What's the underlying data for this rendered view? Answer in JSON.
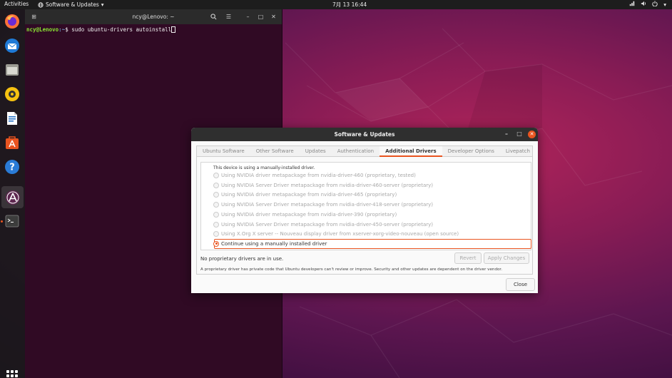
{
  "topbar": {
    "activities": "Activities",
    "app_name": "Software & Updates",
    "clock": "7月 13  16:44"
  },
  "dock": {
    "items": [
      {
        "name": "firefox-icon"
      },
      {
        "name": "thunderbird-icon"
      },
      {
        "name": "files-icon"
      },
      {
        "name": "rhythmbox-icon"
      },
      {
        "name": "libreoffice-writer-icon"
      },
      {
        "name": "software-center-icon"
      },
      {
        "name": "help-icon"
      },
      {
        "name": "software-updater-icon"
      },
      {
        "name": "terminal-icon"
      }
    ]
  },
  "terminal": {
    "title": "ncy@Lenovo: ~",
    "prompt_user": "ncy@Lenovo",
    "prompt_path": ":~",
    "prompt_symbol": "$ ",
    "command": "sudo ubuntu-drivers autoinstall"
  },
  "dialog": {
    "title": "Software & Updates",
    "tabs": [
      {
        "label": "Ubuntu Software",
        "active": false
      },
      {
        "label": "Other Software",
        "active": false
      },
      {
        "label": "Updates",
        "active": false
      },
      {
        "label": "Authentication",
        "active": false
      },
      {
        "label": "Additional Drivers",
        "active": true
      },
      {
        "label": "Developer Options",
        "active": false
      },
      {
        "label": "Livepatch",
        "active": false
      }
    ],
    "device_note": "This device is using a manually-installed driver.",
    "options": [
      {
        "label": "Using NVIDIA driver metapackage from nvidia-driver-460 (proprietary, tested)",
        "selected": false
      },
      {
        "label": "Using NVIDIA Server Driver metapackage from nvidia-driver-460-server (proprietary)",
        "selected": false
      },
      {
        "label": "Using NVIDIA driver metapackage from nvidia-driver-465 (proprietary)",
        "selected": false
      },
      {
        "label": "Using NVIDIA Server Driver metapackage from nvidia-driver-418-server (proprietary)",
        "selected": false
      },
      {
        "label": "Using NVIDIA driver metapackage from nvidia-driver-390 (proprietary)",
        "selected": false
      },
      {
        "label": "Using NVIDIA Server Driver metapackage from nvidia-driver-450-server (proprietary)",
        "selected": false
      },
      {
        "label": "Using X.Org X server -- Nouveau display driver from xserver-xorg-video-nouveau (open source)",
        "selected": false
      },
      {
        "label": "Continue using a manually installed driver",
        "selected": true
      }
    ],
    "status": "No proprietary drivers are in use.",
    "revert_label": "Revert",
    "apply_label": "Apply Changes",
    "footnote": "A proprietary driver has private code that Ubuntu developers can't review or improve. Security and other updates are dependent on the driver vendor.",
    "close_label": "Close"
  },
  "colors": {
    "accent": "#e95420",
    "terminal_bg": "#300a24",
    "topbar_bg": "#1d1d1d"
  }
}
